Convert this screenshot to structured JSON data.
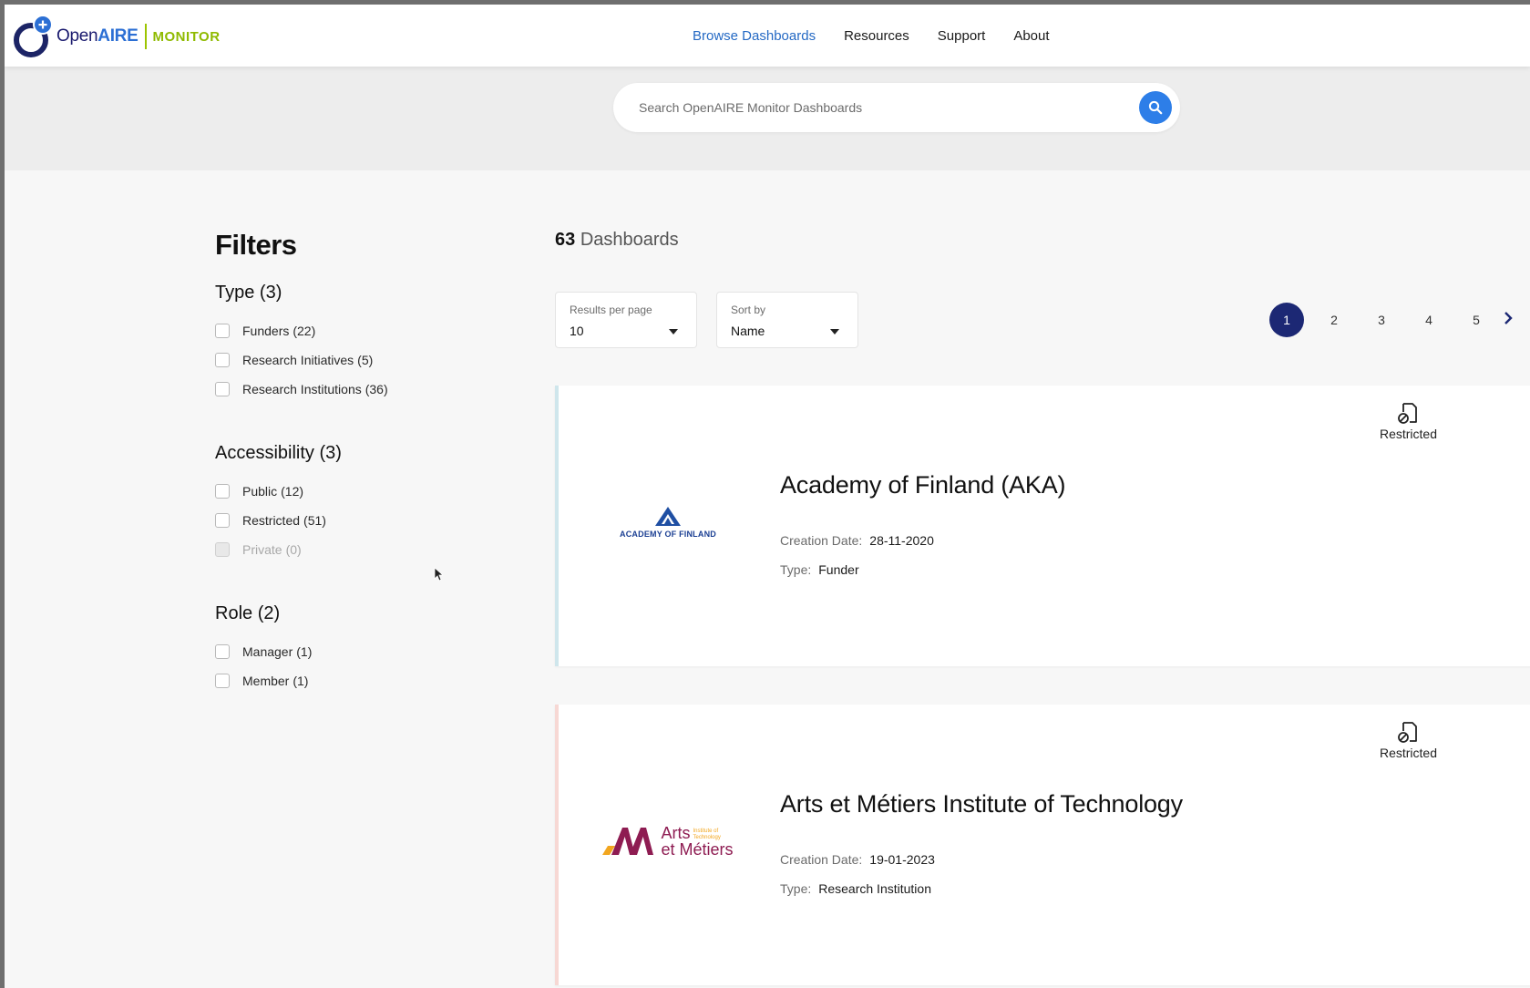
{
  "brand": {
    "open": "Open",
    "aire": "AIRE",
    "monitor": "MONITOR",
    "accent": "#2c6fd4",
    "monitor_color": "#8fba00"
  },
  "nav": [
    {
      "label": "Browse Dashboards",
      "active": true
    },
    {
      "label": "Resources"
    },
    {
      "label": "Support"
    },
    {
      "label": "About"
    }
  ],
  "search": {
    "placeholder": "Search OpenAIRE Monitor Dashboards",
    "icon": "search-icon",
    "color": "#2d7ee8"
  },
  "filters": {
    "title": "Filters",
    "groups": [
      {
        "title": "Type",
        "count": "(3)",
        "options": [
          {
            "label": "Funders",
            "count": "(22)"
          },
          {
            "label": "Research Initiatives",
            "count": "(5)"
          },
          {
            "label": "Research Institutions",
            "count": "(36)"
          }
        ]
      },
      {
        "title": "Accessibility",
        "count": "(3)",
        "options": [
          {
            "label": "Public",
            "count": "(12)"
          },
          {
            "label": "Restricted",
            "count": "(51)"
          },
          {
            "label": "Private",
            "count": "(0)",
            "disabled": true
          }
        ]
      },
      {
        "title": "Role",
        "count": "(2)",
        "options": [
          {
            "label": "Manager",
            "count": "(1)"
          },
          {
            "label": "Member",
            "count": "(1)"
          }
        ]
      }
    ]
  },
  "results": {
    "count": "63",
    "count_label": "Dashboards",
    "per_page": {
      "label": "Results per page",
      "value": "10"
    },
    "sort": {
      "label": "Sort by",
      "value": "Name"
    },
    "pages": [
      "1",
      "2",
      "3",
      "4",
      "5"
    ],
    "active_page": "1",
    "pager_color": "#1c2874"
  },
  "dashboards": [
    {
      "name": "Academy of Finland (AKA)",
      "logo_text": "ACADEMY OF FINLAND",
      "creation_key": "Creation Date:",
      "creation_date": "28-11-2020",
      "type_key": "Type:",
      "type": "Funder",
      "access": "Restricted",
      "accent": "#cfe6ec"
    },
    {
      "name": "Arts et Métiers Institute of Technology",
      "logo_text_main_1": "Arts",
      "logo_text_main_2": "et Métiers",
      "logo_text_small": "Institute of Technology",
      "creation_key": "Creation Date:",
      "creation_date": "19-01-2023",
      "type_key": "Type:",
      "type": "Research Institution",
      "access": "Restricted",
      "accent": "#f7d8d4"
    }
  ]
}
